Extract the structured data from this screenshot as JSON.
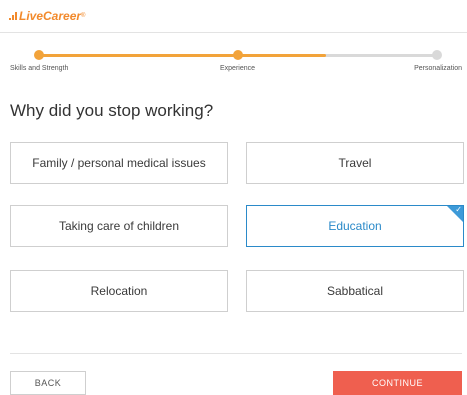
{
  "brand": {
    "name": "LiveCareer",
    "trademark": "®",
    "accent": "#f28a2c"
  },
  "progress": {
    "fill_fraction": 0.72,
    "steps": [
      {
        "label": "Skills and Strength",
        "state": "done"
      },
      {
        "label": "Experience",
        "state": "done"
      },
      {
        "label": "Personalization",
        "state": "todo"
      }
    ]
  },
  "question": "Why did you stop working?",
  "options": [
    {
      "label": "Family / personal medical issues",
      "selected": false
    },
    {
      "label": "Travel",
      "selected": false
    },
    {
      "label": "Taking care of children",
      "selected": false
    },
    {
      "label": "Education",
      "selected": true
    },
    {
      "label": "Relocation",
      "selected": false
    },
    {
      "label": "Sabbatical",
      "selected": false
    }
  ],
  "selected_icon": "checkmark-icon",
  "footer": {
    "back_label": "BACK",
    "continue_label": "CONTINUE",
    "continue_color": "#ef5f4f"
  }
}
